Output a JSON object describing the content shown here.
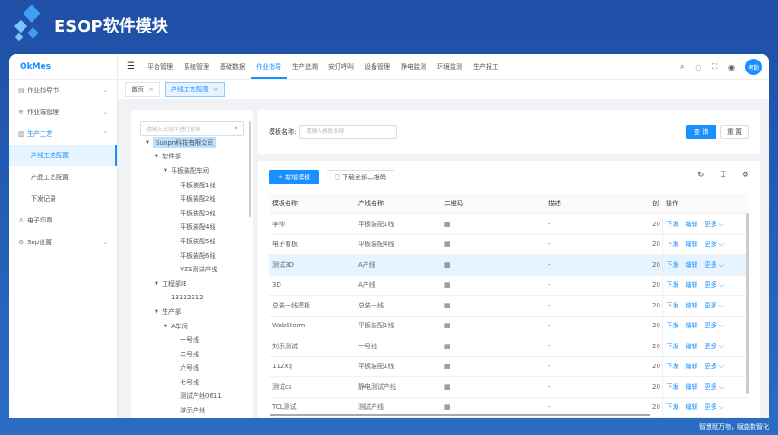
{
  "header": {
    "title": "ESOP软件模块",
    "slogan": "智慧赋万物，赋能数智化"
  },
  "sidebar": {
    "brand": "OkMes",
    "items": [
      {
        "label": "作业指导书",
        "icon": "file-icon"
      },
      {
        "label": "作业端管理",
        "icon": "wave-icon"
      },
      {
        "label": "生产工艺",
        "icon": "book-icon",
        "expanded": true,
        "children": [
          {
            "label": "产线工艺配置",
            "selected": true
          },
          {
            "label": "产品工艺配置"
          },
          {
            "label": "下发记录"
          }
        ]
      },
      {
        "label": "电子印章",
        "icon": "stamp-icon"
      },
      {
        "label": "Sop设置",
        "icon": "settings-icon"
      }
    ]
  },
  "topnav": {
    "items": [
      "平台管理",
      "系统管理",
      "基础数据",
      "作业指导",
      "生产追溯",
      "安灯呼叫",
      "设备管理",
      "静电监测",
      "环境监测",
      "生产报工"
    ],
    "active": "作业指导",
    "avatar": "考勤"
  },
  "tabs": [
    {
      "label": "首页"
    },
    {
      "label": "产线工艺配置",
      "active": true
    }
  ],
  "tree": {
    "placeholder": "请输入关键字进行搜索",
    "nodes": [
      {
        "label": "Sunpn科技有限公司",
        "level": 0,
        "arrow": true,
        "selected": true
      },
      {
        "label": "软件部",
        "level": 1,
        "arrow": true
      },
      {
        "label": "平板装配车间",
        "level": 2,
        "arrow": true
      },
      {
        "label": "平板装配1线",
        "level": 3
      },
      {
        "label": "平板装配2线",
        "level": 3
      },
      {
        "label": "平板装配3线",
        "level": 3
      },
      {
        "label": "平板装配4线",
        "level": 3
      },
      {
        "label": "平板装配5线",
        "level": 3
      },
      {
        "label": "平板装配6线",
        "level": 3
      },
      {
        "label": "YZS测试产线",
        "level": 3
      },
      {
        "label": "工程部IE",
        "level": 1,
        "arrow": true
      },
      {
        "label": "13122312",
        "level": 2
      },
      {
        "label": "生产部",
        "level": 1,
        "arrow": true
      },
      {
        "label": "A车间",
        "level": 2,
        "arrow": true
      },
      {
        "label": "一号线",
        "level": 3
      },
      {
        "label": "二号线",
        "level": 3
      },
      {
        "label": "六号线",
        "level": 3
      },
      {
        "label": "七号线",
        "level": 3
      },
      {
        "label": "测试产线0611",
        "level": 3
      },
      {
        "label": "演示产线",
        "level": 3
      }
    ]
  },
  "search": {
    "label": "模板名称:",
    "placeholder": "请输入模板名称",
    "query": "查 询",
    "reset": "重 置"
  },
  "toolbar": {
    "new": "+ 新增模板",
    "download": "下载全部二维码"
  },
  "table": {
    "headers": [
      "模板名称",
      "产线名称",
      "二维码",
      "描述",
      "创",
      "操作"
    ],
    "actions": [
      "下发",
      "编辑",
      "更多 ⌵"
    ],
    "rows": [
      [
        "李帅",
        "平板装配1线",
        "▦",
        "-",
        "20"
      ],
      [
        "电子看板",
        "平板装配4线",
        "▦",
        "-",
        "20"
      ],
      [
        "测试3D",
        "A产线",
        "▦",
        "-",
        "20"
      ],
      [
        "3D",
        "A产线",
        "▦",
        "-",
        "20"
      ],
      [
        "总装一线模板",
        "总装一线",
        "▦",
        "-",
        "20"
      ],
      [
        "WebStorm",
        "平板装配1线",
        "▦",
        "-",
        "20"
      ],
      [
        "刘乐测试",
        "一号线",
        "▦",
        "-",
        "20"
      ],
      [
        "112xq",
        "平板装配1线",
        "▦",
        "-",
        "20"
      ],
      [
        "测试cs",
        "静电测试产线",
        "▦",
        "-",
        "20"
      ],
      [
        "TCL测试",
        "测试产线",
        "▦",
        "-",
        "20"
      ]
    ],
    "highlighted_row": 2
  }
}
